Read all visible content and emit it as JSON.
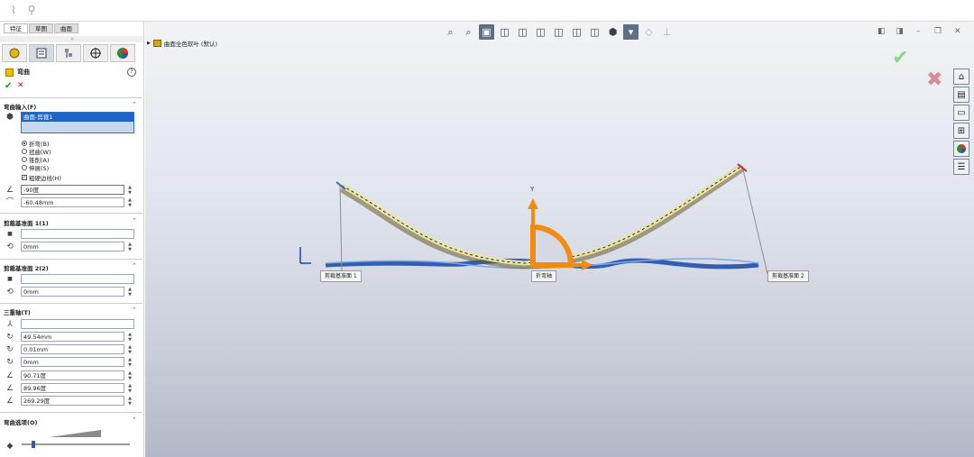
{
  "topbar": {
    "icons": [
      "sketch-icon",
      "pin-icon"
    ]
  },
  "panel": {
    "tabs": [
      "特征",
      "草图",
      "曲面"
    ],
    "grip": "»",
    "feature_title": "弯曲",
    "help": "?",
    "bend_input": {
      "heading": "弯曲输入(F)",
      "selected_item": "曲面-剪裁1",
      "options": [
        "折弯(B)",
        "扭曲(W)",
        "锥削(A)",
        "伸展(S)"
      ],
      "selected_option": 0,
      "rigid_edges_label": "粗硬边线(H)",
      "angle": "-90度",
      "radius": "-60.48mm"
    },
    "trim_plane1": {
      "heading": "剪裁基准面 1(1)",
      "value": "0mm"
    },
    "trim_plane2": {
      "heading": "剪裁基准面 2(2)",
      "value": "0mm"
    },
    "triad": {
      "heading": "三重轴(T)",
      "values": [
        "49.54mm",
        "0.01mm",
        "0mm",
        "90.71度",
        "89.96度",
        "269.29度"
      ]
    },
    "bend_options": {
      "heading": "弯曲选项(O)"
    }
  },
  "viewport": {
    "tree_label": "曲面全色软叶 (默认)",
    "axis_y": "Y",
    "callouts": {
      "plane1": "剪裁基准面 1",
      "bend_axis": "折弯轴",
      "plane2": "剪裁基准面 2"
    }
  },
  "colors": {
    "accent": "#1e63c6",
    "curve": "#e8e4a8",
    "orange": "#f28c0f",
    "blue": "#2464c8"
  }
}
